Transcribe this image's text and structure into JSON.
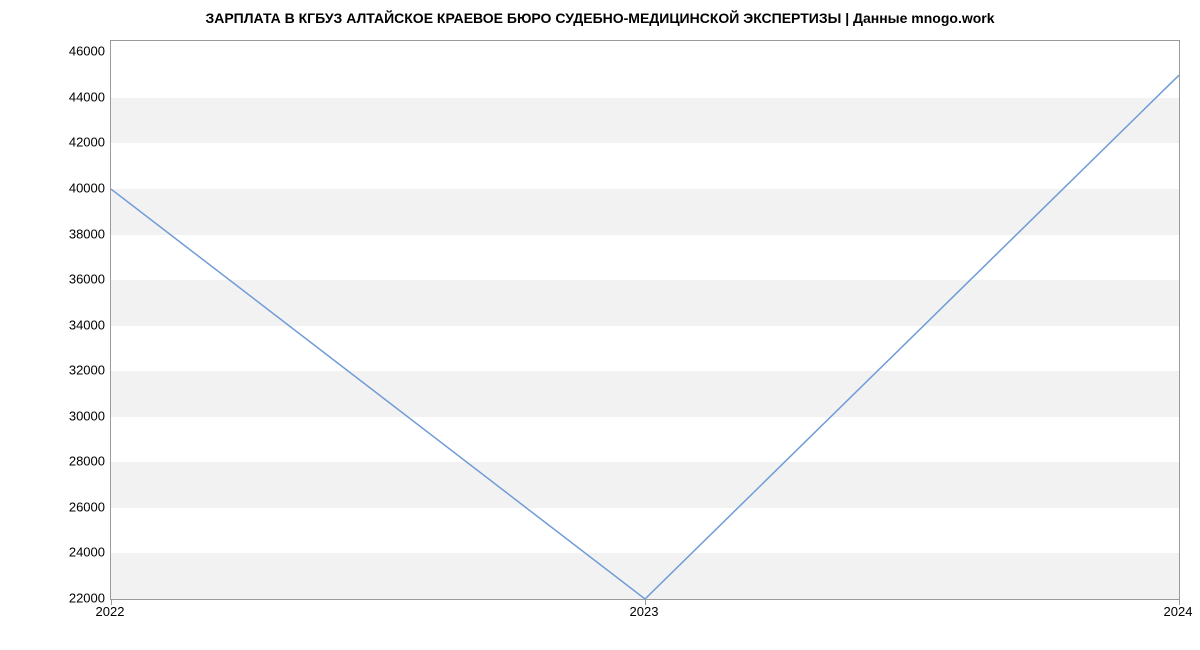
{
  "chart_data": {
    "type": "line",
    "title": "ЗАРПЛАТА В КГБУЗ АЛТАЙСКОЕ КРАЕВОЕ БЮРО СУДЕБНО-МЕДИЦИНСКОЙ ЭКСПЕРТИЗЫ | Данные mnogo.work",
    "x": [
      "2022",
      "2023",
      "2024"
    ],
    "values": [
      40000,
      22000,
      45000
    ],
    "x_ticks": [
      "2022",
      "2023",
      "2024"
    ],
    "y_ticks": [
      22000,
      24000,
      26000,
      28000,
      30000,
      32000,
      34000,
      36000,
      38000,
      40000,
      42000,
      44000,
      46000
    ],
    "ylim": [
      22000,
      46500
    ],
    "xlabel": "",
    "ylabel": "",
    "line_color": "#6f9bd8",
    "band_color": "#f2f2f2"
  }
}
